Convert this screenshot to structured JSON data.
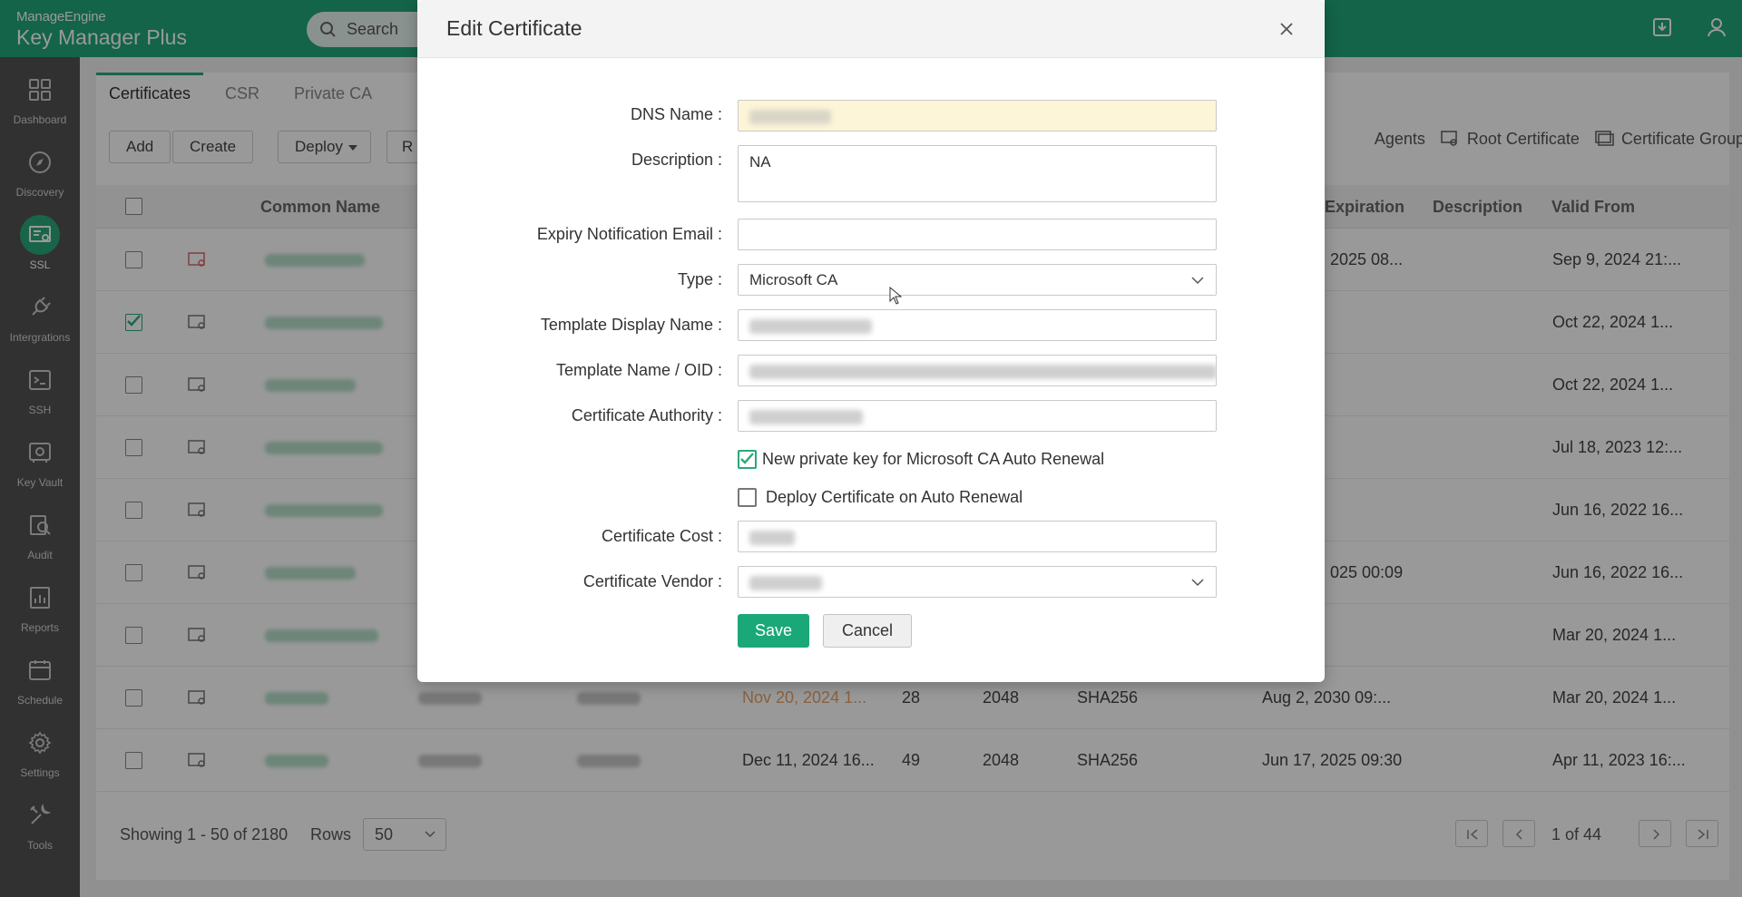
{
  "app": {
    "logo_line1": "ManageEngine",
    "logo_line2_a": "Key Manager",
    "logo_line2_b": " Plus",
    "search_placeholder": "Search"
  },
  "sidebar": {
    "items": [
      {
        "label": "Dashboard",
        "icon": "dashboard-icon"
      },
      {
        "label": "Discovery",
        "icon": "compass-icon"
      },
      {
        "label": "SSL",
        "icon": "certificate-icon",
        "active": true
      },
      {
        "label": "Intergrations",
        "icon": "plug-icon"
      },
      {
        "label": "SSH",
        "icon": "terminal-icon"
      },
      {
        "label": "Key Vault",
        "icon": "vault-icon"
      },
      {
        "label": "Audit",
        "icon": "audit-icon"
      },
      {
        "label": "Reports",
        "icon": "reports-icon"
      },
      {
        "label": "Schedule",
        "icon": "calendar-icon"
      },
      {
        "label": "Settings",
        "icon": "gear-icon"
      },
      {
        "label": "Tools",
        "icon": "tools-icon"
      }
    ]
  },
  "tabs": [
    "Certificates",
    "CSR",
    "Private CA"
  ],
  "toolbar": {
    "add": "Add",
    "create": "Create",
    "deploy": "Deploy",
    "more": "R",
    "agents": "Agents",
    "root_certificate": "Root Certificate",
    "certificate_group": "Certificate Group"
  },
  "table": {
    "headers": {
      "common_name": "Common Name",
      "expiration": "Expiration",
      "description": "Description",
      "valid_from": "Valid From"
    },
    "rows": [
      {
        "expires": "",
        "days": "",
        "key": "",
        "alg": "",
        "expiration": "2025 08...",
        "valid_from": "Sep 9, 2024 21:..."
      },
      {
        "expires": "",
        "days": "",
        "key": "",
        "alg": "",
        "expiration": "",
        "valid_from": "Oct 22, 2024 1..."
      },
      {
        "expires": "",
        "days": "",
        "key": "",
        "alg": "",
        "expiration": "",
        "valid_from": "Oct 22, 2024 1..."
      },
      {
        "expires": "",
        "days": "",
        "key": "",
        "alg": "",
        "expiration": "",
        "valid_from": "Jul 18, 2023 12:..."
      },
      {
        "expires": "",
        "days": "",
        "key": "",
        "alg": "",
        "expiration": "",
        "valid_from": "Jun 16, 2022 16..."
      },
      {
        "expires": "",
        "days": "",
        "key": "",
        "alg": "",
        "expiration": "025 00:09",
        "valid_from": "Jun 16, 2022 16..."
      },
      {
        "expires": "",
        "days": "",
        "key": "",
        "alg": "",
        "expiration": "",
        "valid_from": "Mar 20, 2024 1..."
      },
      {
        "expires": "Nov 20, 2024 1...",
        "days": "28",
        "key": "2048",
        "alg": "SHA256",
        "expiration": "Aug 2, 2030 09:...",
        "valid_from": "Mar 20, 2024 1..."
      },
      {
        "expires": "Dec 11, 2024 16...",
        "days": "49",
        "key": "2048",
        "alg": "SHA256",
        "expiration": "Jun 17, 2025 09:30",
        "valid_from": "Apr 11, 2023 16:..."
      }
    ]
  },
  "footer": {
    "showing": "Showing 1 - 50 of 2180",
    "rows_label": "Rows",
    "rows_value": "50",
    "page": "1 of 44"
  },
  "modal": {
    "title": "Edit Certificate",
    "labels": {
      "dns": "DNS Name :",
      "description": "Description :",
      "email": "Expiry Notification Email :",
      "type": "Type :",
      "template_display": "Template Display Name :",
      "template_oid": "Template Name / OID :",
      "ca": "Certificate Authority :",
      "cost": "Certificate Cost :",
      "vendor": "Certificate Vendor :"
    },
    "values": {
      "description": "NA",
      "email": "",
      "type": "Microsoft CA"
    },
    "checkboxes": {
      "new_private_key": {
        "label": "New private key for Microsoft CA Auto Renewal",
        "checked": true
      },
      "deploy_cert": {
        "label": "Deploy Certificate on Auto Renewal",
        "checked": false
      }
    },
    "save": "Save",
    "cancel": "Cancel"
  },
  "colors": {
    "accent": "#21a779",
    "sidebar": "#525252",
    "dns_highlight": "#fdf5d8",
    "expiry_warning": "#e7a36a"
  }
}
